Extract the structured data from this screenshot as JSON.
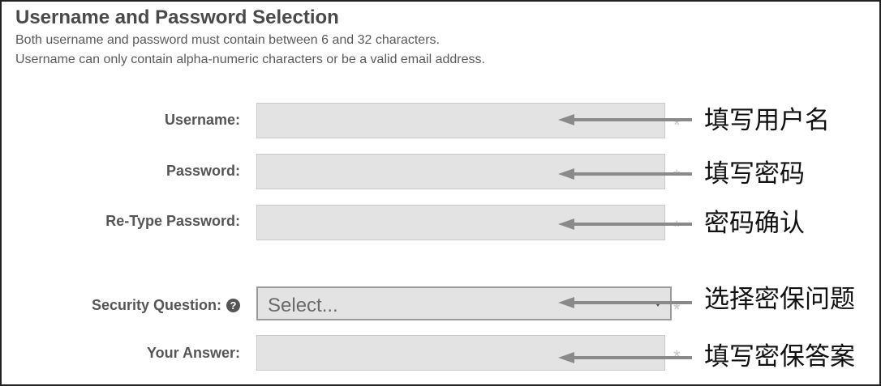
{
  "section": {
    "title": "Username and Password Selection",
    "description_line1": "Both username and password must contain between 6 and 32 characters.",
    "description_line2": "Username can only contain alpha-numeric characters or be a valid email address."
  },
  "fields": {
    "username": {
      "label": "Username:",
      "value": "",
      "required_mark": "*",
      "annotation": "填写用户名"
    },
    "password": {
      "label": "Password:",
      "value": "",
      "required_mark": "*",
      "annotation": "填写密码"
    },
    "retype_password": {
      "label": "Re-Type Password:",
      "value": "",
      "required_mark": "*",
      "annotation": "密码确认"
    },
    "security_question": {
      "label": "Security Question:",
      "help_icon": "question-circle-icon",
      "help_glyph": "?",
      "selected": "Select...",
      "required_mark": "*",
      "annotation": "选择密保问题"
    },
    "your_answer": {
      "label": "Your Answer:",
      "value": "",
      "required_mark": "*",
      "annotation": "填写密保答案"
    }
  },
  "colors": {
    "input_bg": "#e3e3e3",
    "label_text": "#555555",
    "arrow": "#8a8a8a",
    "annotation_text": "#111111"
  }
}
